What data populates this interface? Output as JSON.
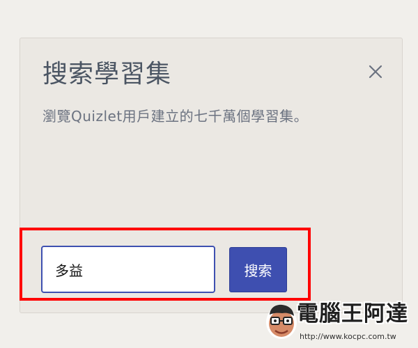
{
  "dialog": {
    "title": "搜索學習集",
    "description": "瀏覽Quizlet用戶建立的七千萬個學習集。",
    "close_icon": "close-icon"
  },
  "search": {
    "value": "多益",
    "button_label": "搜索"
  },
  "watermark": {
    "title": "電腦王阿達",
    "url": "http://www.kocpc.com.tw"
  },
  "colors": {
    "page_background": "#f1efeb",
    "card_background": "#ebe8e3",
    "button": "#3e4fb0",
    "highlight": "#ff0000"
  }
}
